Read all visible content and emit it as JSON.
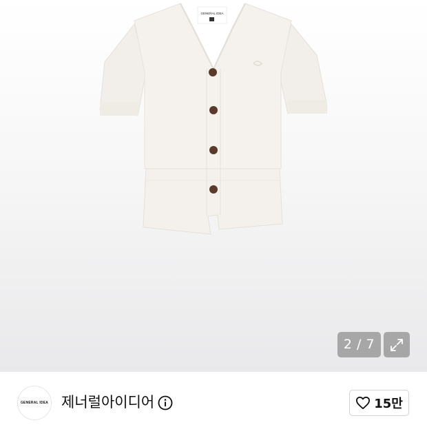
{
  "gallery": {
    "counter": "2 / 7",
    "expand_icon": "expand-arrows-icon",
    "garment_label": "GENERAL IDEA"
  },
  "brand": {
    "logo_text": "GENERAL IDEA",
    "name": "제너럴아이디어",
    "info_icon": "info-circle-icon"
  },
  "like": {
    "icon": "heart-outline-icon",
    "count": "15만"
  },
  "colors": {
    "garment": "#f4f1ec",
    "button": "#5a3a2a",
    "overlay": "#8c8c8c"
  }
}
